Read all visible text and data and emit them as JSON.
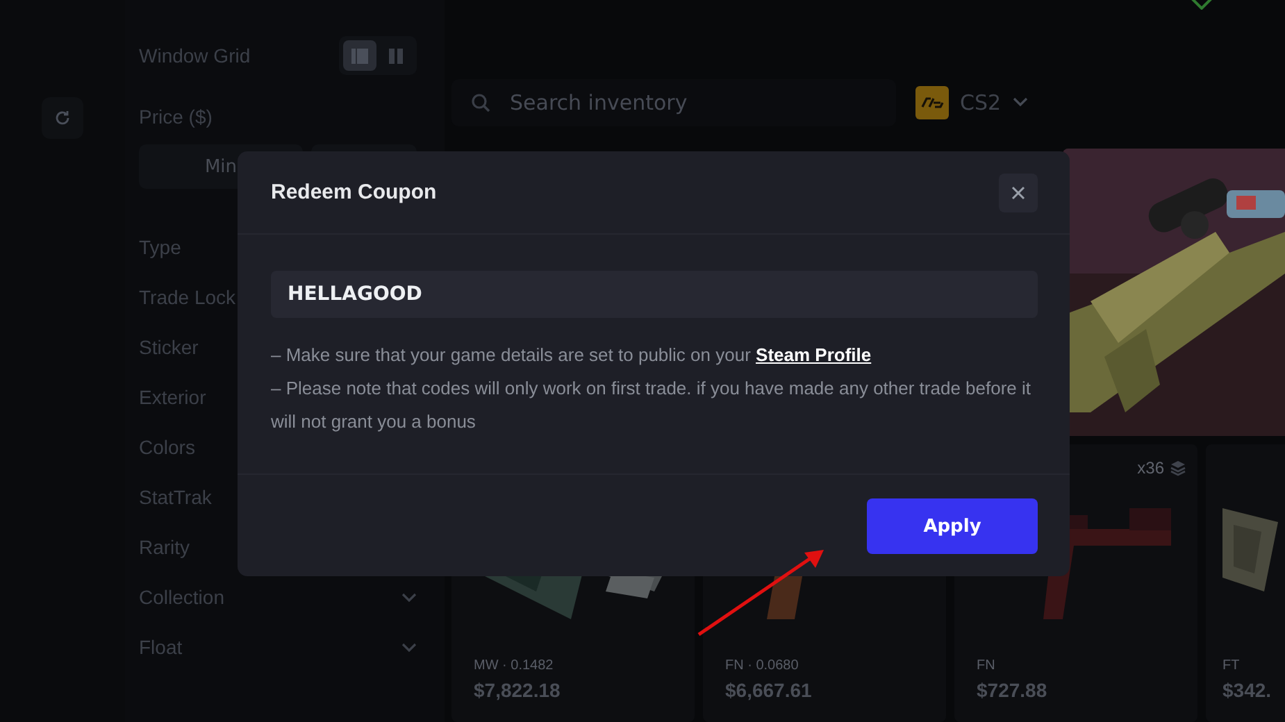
{
  "filters": {
    "window_grid_label": "Window Grid",
    "grid_modes": [
      {
        "selected": true
      },
      {
        "selected": false
      }
    ],
    "price_label": "Price ($)",
    "min_placeholder": "Min",
    "items": [
      {
        "label": "Type"
      },
      {
        "label": "Trade Lock"
      },
      {
        "label": "Sticker"
      },
      {
        "label": "Exterior"
      },
      {
        "label": "Colors"
      },
      {
        "label": "StatTrak"
      },
      {
        "label": "Rarity"
      },
      {
        "label": "Collection",
        "chevron": true
      },
      {
        "label": "Float",
        "chevron": true
      }
    ]
  },
  "search": {
    "placeholder": "Search inventory"
  },
  "game_selector": {
    "label": "CS2"
  },
  "items": [
    {
      "wear": "MW · 0.1482",
      "price": "$7,822.18"
    },
    {
      "wear": "FN · 0.0680",
      "price": "$6,667.61"
    },
    {
      "wear": "FN",
      "price": "$727.88",
      "count": "x36"
    },
    {
      "wear": "FT",
      "price": "$342."
    }
  ],
  "modal": {
    "title": "Redeem Coupon",
    "code": "HELLAGOOD",
    "notes": [
      {
        "text": "– Make sure that your game details are set to public on your ",
        "link": "Steam Profile"
      },
      {
        "text": "– Please note that codes will only work on first trade. if you have made any other trade before it will not grant you a bonus"
      }
    ],
    "apply": "Apply"
  }
}
